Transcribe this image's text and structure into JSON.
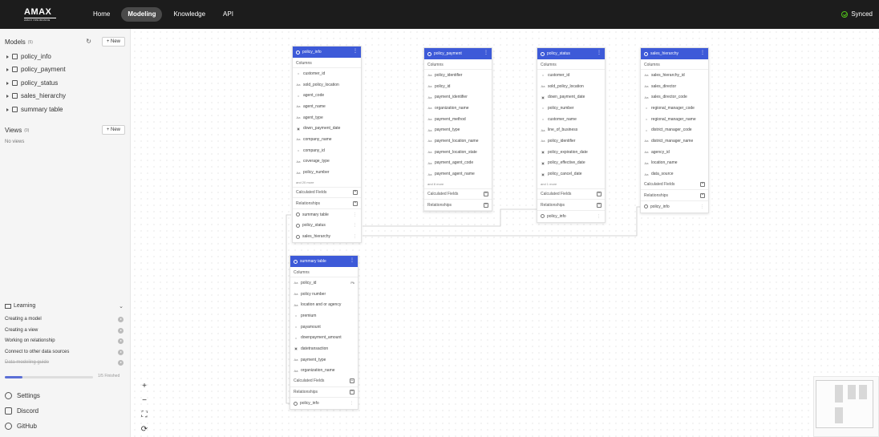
{
  "app": {
    "logo_text": "AMAX",
    "logo_sub": "AMAX INSURANCE",
    "nav": [
      "Home",
      "Modeling",
      "Knowledge",
      "API"
    ],
    "active_nav": "Modeling",
    "sync_status": "Synced"
  },
  "sidebar": {
    "models_title": "Models",
    "models_count": "(5)",
    "new_label": "New",
    "models": [
      "policy_info",
      "policy_payment",
      "policy_status",
      "sales_hierarchy",
      "summary table"
    ],
    "views_title": "Views",
    "views_count": "(0)",
    "no_views": "No views",
    "learning_title": "Learning",
    "learning_items": [
      {
        "label": "Creating a model",
        "done": false
      },
      {
        "label": "Creating a view",
        "done": false
      },
      {
        "label": "Working on relationship",
        "done": false
      },
      {
        "label": "Connect to other data sources",
        "done": false
      },
      {
        "label": "Data modeling guide",
        "done": true
      }
    ],
    "progress_text": "1/5 Finished",
    "progress_fraction": 0.2,
    "links": [
      {
        "label": "Settings",
        "icon": "gear-icon"
      },
      {
        "label": "Discord",
        "icon": "discord-icon"
      },
      {
        "label": "GitHub",
        "icon": "github-icon"
      }
    ]
  },
  "canvas": {
    "columns_label": "Columns",
    "calculated_label": "Calculated Fields",
    "relationships_label": "Relationships",
    "models": {
      "policy_info": {
        "title": "policy_info",
        "fields": [
          {
            "type": "=",
            "name": "customer_id"
          },
          {
            "type": "Aa",
            "name": "sold_policy_location"
          },
          {
            "type": "=",
            "name": "agent_code"
          },
          {
            "type": "Aa",
            "name": "agent_name"
          },
          {
            "type": "Aa",
            "name": "agent_type"
          },
          {
            "type": "▣",
            "name": "down_payment_date"
          },
          {
            "type": "Aa",
            "name": "company_name"
          },
          {
            "type": "=",
            "name": "company_id"
          },
          {
            "type": "Aa",
            "name": "coverage_type"
          },
          {
            "type": "Aa",
            "name": "policy_number"
          }
        ],
        "more": "and 20 more",
        "relationships": [
          "summary table",
          "policy_status",
          "sales_hierarchy"
        ]
      },
      "policy_payment": {
        "title": "policy_payment",
        "fields": [
          {
            "type": "Aa",
            "name": "policy_identifier"
          },
          {
            "type": "Aa",
            "name": "policy_id"
          },
          {
            "type": "Aa",
            "name": "payment_identifier"
          },
          {
            "type": "Aa",
            "name": "organization_name"
          },
          {
            "type": "Aa",
            "name": "payment_method"
          },
          {
            "type": "Aa",
            "name": "payment_type"
          },
          {
            "type": "Aa",
            "name": "payment_location_name"
          },
          {
            "type": "Aa",
            "name": "payment_location_state"
          },
          {
            "type": "Aa",
            "name": "payment_agent_code"
          },
          {
            "type": "Aa",
            "name": "payment_agent_name"
          }
        ],
        "more": "and 8 more",
        "relationships": []
      },
      "policy_status": {
        "title": "policy_status",
        "fields": [
          {
            "type": "=",
            "name": "customer_id"
          },
          {
            "type": "Aa",
            "name": "sold_policy_location"
          },
          {
            "type": "▣",
            "name": "down_payment_date"
          },
          {
            "type": "=",
            "name": "policy_number"
          },
          {
            "type": "=",
            "name": "customer_name"
          },
          {
            "type": "Aa",
            "name": "line_of_business"
          },
          {
            "type": "Aa",
            "name": "policy_identifier"
          },
          {
            "type": "▣",
            "name": "policy_expiration_date"
          },
          {
            "type": "▣",
            "name": "policy_effective_date"
          },
          {
            "type": "▣",
            "name": "policy_cancel_date"
          }
        ],
        "more": "and 1 more",
        "relationships": [
          "policy_info"
        ]
      },
      "sales_hierarchy": {
        "title": "sales_hierarchy",
        "fields": [
          {
            "type": "Aa",
            "name": "sales_hierarchy_id"
          },
          {
            "type": "Aa",
            "name": "sales_director"
          },
          {
            "type": "Aa",
            "name": "sales_director_code"
          },
          {
            "type": "=",
            "name": "regional_manager_code"
          },
          {
            "type": "=",
            "name": "regional_manager_name"
          },
          {
            "type": "=",
            "name": "district_manager_code"
          },
          {
            "type": "Aa",
            "name": "district_manager_name"
          },
          {
            "type": "Aa",
            "name": "agency_id"
          },
          {
            "type": "Aa",
            "name": "location_name"
          },
          {
            "type": "Aa",
            "name": "data_source"
          }
        ],
        "more": "",
        "relationships": [
          "policy_info"
        ]
      },
      "summary_table": {
        "title": "summary table",
        "fields": [
          {
            "type": "Aa",
            "name": "policy_id",
            "pk": "Pk"
          },
          {
            "type": "Aa",
            "name": "policy number"
          },
          {
            "type": "Aa",
            "name": "location and or agency"
          },
          {
            "type": "=",
            "name": "premium"
          },
          {
            "type": "=",
            "name": "payamount"
          },
          {
            "type": "=",
            "name": "downpayment_amount"
          },
          {
            "type": "▣",
            "name": "datetransaction"
          },
          {
            "type": "Aa",
            "name": "payment_type"
          },
          {
            "type": "Aa",
            "name": "organization_name"
          }
        ],
        "more": "",
        "relationships": [
          "policy_info"
        ]
      }
    }
  },
  "zoom_controls": [
    "+",
    "−",
    "⛶",
    "⟳"
  ],
  "colors": {
    "topbar": "#1c1c1c",
    "model_header": "#3d5ad8",
    "sidebar_bg": "#f5f5f5",
    "progress": "#5b6fd6",
    "synced": "#52c41a"
  }
}
